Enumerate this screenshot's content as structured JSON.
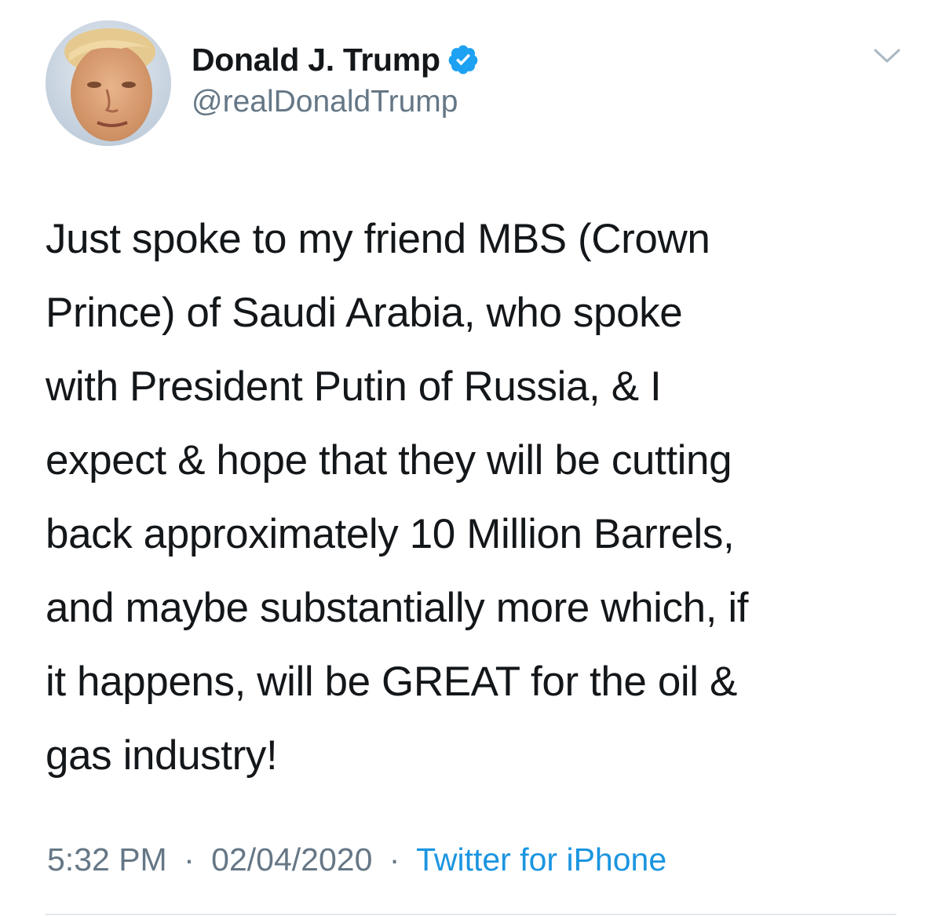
{
  "author": {
    "display_name": "Donald J. Trump",
    "handle": "@realDonaldTrump",
    "verified": true,
    "avatar_icon": "profile-photo"
  },
  "tweet": {
    "text": "Just spoke to my friend MBS (Crown\nPrince) of Saudi Arabia, who spoke\nwith President Putin of Russia, & I\nexpect & hope that they will be cutting\nback approximately 10 Million Barrels,\nand maybe substantially more which, if\nit happens, will be GREAT for the oil &\ngas industry!"
  },
  "meta": {
    "time": "5:32 PM",
    "separator": "·",
    "date": "02/04/2020",
    "source": "Twitter for iPhone"
  },
  "icons": {
    "verified": "verified-badge-icon",
    "menu": "chevron-down-icon"
  },
  "colors": {
    "text": "#14171a",
    "secondary": "#657786",
    "link": "#1b95e0",
    "verified": "#1da1f2",
    "divider": "#e1e8ed"
  }
}
